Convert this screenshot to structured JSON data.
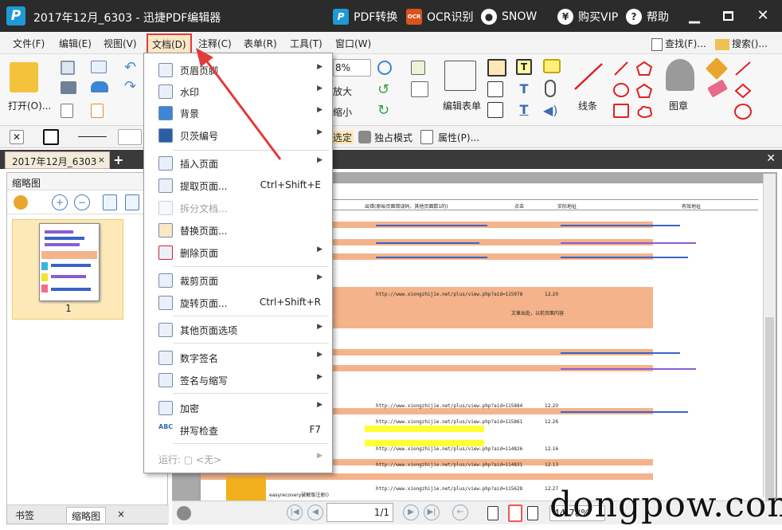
{
  "window": {
    "title": "2017年12月_6303 - 迅捷PDF编辑器",
    "logo_letter": "P",
    "buttons": {
      "pdf_convert": "PDF转换",
      "ocr": "OCR识别",
      "user": "SNOW",
      "vip": "购买VIP",
      "help": "帮助"
    },
    "ocr_badge": "OCR",
    "vip_symbol": "¥",
    "help_symbol": "?"
  },
  "menubar": {
    "items": [
      "文件(F)",
      "编辑(E)",
      "视图(V)",
      "文档(D)",
      "注释(C)",
      "表单(R)",
      "工具(T)",
      "窗口(W)"
    ],
    "active_index": 3,
    "right": {
      "find": "查找(F)...",
      "search": "搜索()..."
    }
  },
  "ribbon": {
    "open_label": "打开(O)...",
    "zoom_value": "8%",
    "zoom_in_label": "放大",
    "zoom_out_label": "缩小",
    "edit_form_label": "编辑表单",
    "line_label": "线条",
    "stamp_label": "图章"
  },
  "subtoolbar": {
    "select_label": "选定",
    "exclusive_label": "独占模式",
    "properties_label": "属性(P)..."
  },
  "tabs": {
    "doc_tab": "2017年12月_6303",
    "close_symbol": "×",
    "add_symbol": "+"
  },
  "leftpanel": {
    "title": "缩略图",
    "page_number": "1",
    "bottom_tabs": [
      "书签",
      "缩略图"
    ]
  },
  "document_menu": {
    "items": [
      {
        "label": "页眉页脚",
        "shortcut": "",
        "submenu": true,
        "disabled": false,
        "icon": "header-footer-icon"
      },
      {
        "label": "水印",
        "shortcut": "",
        "submenu": true,
        "disabled": false,
        "icon": "watermark-icon"
      },
      {
        "label": "背景",
        "shortcut": "",
        "submenu": true,
        "disabled": false,
        "icon": "background-icon"
      },
      {
        "label": "贝茨编号",
        "shortcut": "",
        "submenu": true,
        "disabled": false,
        "icon": "bates-number-icon"
      },
      {
        "label": "插入页面",
        "shortcut": "",
        "submenu": true,
        "disabled": false,
        "icon": "insert-page-icon"
      },
      {
        "label": "提取页面...",
        "shortcut": "Ctrl+Shift+E",
        "submenu": false,
        "disabled": false,
        "icon": "extract-page-icon"
      },
      {
        "label": "拆分文档...",
        "shortcut": "",
        "submenu": false,
        "disabled": true,
        "icon": "split-document-icon"
      },
      {
        "label": "替换页面...",
        "shortcut": "",
        "submenu": false,
        "disabled": false,
        "icon": "replace-page-icon"
      },
      {
        "label": "删除页面",
        "shortcut": "",
        "submenu": true,
        "disabled": false,
        "icon": "delete-page-icon"
      },
      {
        "label": "裁剪页面",
        "shortcut": "",
        "submenu": true,
        "disabled": false,
        "icon": "crop-page-icon"
      },
      {
        "label": "旋转页面...",
        "shortcut": "Ctrl+Shift+R",
        "submenu": false,
        "disabled": false,
        "icon": "rotate-page-icon"
      },
      {
        "label": "其他页面选项",
        "shortcut": "",
        "submenu": true,
        "disabled": false,
        "icon": "page-options-icon"
      },
      {
        "label": "数字签名",
        "shortcut": "",
        "submenu": true,
        "disabled": false,
        "icon": "digital-signature-icon"
      },
      {
        "label": "签名与缩写",
        "shortcut": "",
        "submenu": true,
        "disabled": false,
        "icon": "sign-initials-icon"
      },
      {
        "label": "加密",
        "shortcut": "",
        "submenu": true,
        "disabled": false,
        "icon": "encrypt-icon"
      },
      {
        "label": "拼写检查",
        "shortcut": "F7",
        "submenu": false,
        "disabled": false,
        "icon": "spell-check-icon"
      },
      {
        "label": "运行: ▢ <无>",
        "shortcut": "",
        "submenu": true,
        "disabled": true,
        "icon": ""
      }
    ],
    "spell_icon_text": "ABC"
  },
  "statusbar": {
    "page_display": "1/1",
    "zoom_display": "44.78%"
  },
  "page_content": {
    "header_cells": [
      "出错(原始页面错误码，其他页面数1的)",
      "点击",
      "实际地址",
      "有效地址"
    ],
    "rows": [
      "http://www.xiongzhijie.net/plus/view.php?aid=115078",
      "12.20",
      "文章出处，以前页面内容",
      "http://www.xiongzhijie.net/plus/view.php?aid=115884",
      "12.20",
      "http://www.xiongzhijie.net/plus/view.php?aid=115861",
      "12.26",
      "http://www.xiongzhijie.net/plus/view.php?aid=114826",
      "12.16",
      "http://www.xiongzhijie.net/plus/view.php?aid=114831",
      "12.13",
      "http://www.xiongzhijie.net/plus/view.php?aid=115628",
      "12.27",
      "easyrecovery破解版注册()"
    ]
  },
  "watermark_text": "dongpow.com",
  "colors": {
    "titlebar": "#2b2b2b",
    "menu_highlight_border": "#e23b3b",
    "menu_highlight_bg": "#fbe7c7",
    "thumb_selected": "#fde9b7",
    "row_highlight": "#f4b38a",
    "yellow_highlight": "#ffff33",
    "arrow": "#e23b3b"
  }
}
